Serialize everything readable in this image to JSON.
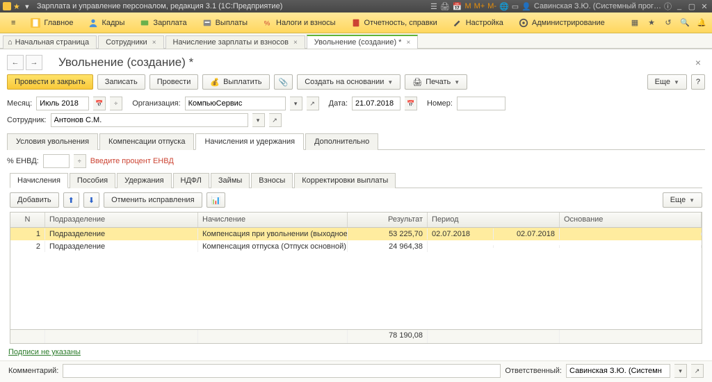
{
  "titlebar": {
    "app": "Зарплата и управление персоналом, редакция 3.1  (1С:Предприятие)",
    "user": "Савинская З.Ю. (Системный прог…"
  },
  "mainmenu": {
    "items": [
      "Главное",
      "Кадры",
      "Зарплата",
      "Выплаты",
      "Налоги и взносы",
      "Отчетность, справки",
      "Настройка",
      "Администрирование"
    ]
  },
  "tabs": {
    "items": [
      {
        "label": "Начальная страница",
        "home": true
      },
      {
        "label": "Сотрудники",
        "close": true
      },
      {
        "label": "Начисление зарплаты и взносов",
        "close": true
      },
      {
        "label": "Увольнение (создание) *",
        "close": true,
        "active": true
      }
    ]
  },
  "page": {
    "title": "Увольнение (создание) *"
  },
  "toolbar": {
    "post_close": "Провести и закрыть",
    "write": "Записать",
    "post": "Провести",
    "pay": "Выплатить",
    "create": "Создать на основании",
    "print": "Печать",
    "more": "Еще"
  },
  "form": {
    "month_lbl": "Месяц:",
    "month": "Июль 2018",
    "org_lbl": "Организация:",
    "org": "КомпьюСервис",
    "date_lbl": "Дата:",
    "date": "21.07.2018",
    "number_lbl": "Номер:",
    "number": "",
    "emp_lbl": "Сотрудник:",
    "emp": "Антонов С.М."
  },
  "subtabs": {
    "items": [
      "Условия увольнения",
      "Компенсации отпуска",
      "Начисления и удержания",
      "Дополнительно"
    ],
    "active": 2
  },
  "envd": {
    "lbl": "% ЕНВД:",
    "val": "",
    "warn": "Введите процент ЕНВД"
  },
  "innertabs": {
    "items": [
      "Начисления",
      "Пособия",
      "Удержания",
      "НДФЛ",
      "Займы",
      "Взносы",
      "Корректировки выплаты"
    ],
    "active": 0
  },
  "tabletools": {
    "add": "Добавить",
    "cancel": "Отменить исправления",
    "more": "Еще"
  },
  "grid": {
    "cols": {
      "n": "N",
      "sub": "Подразделение",
      "nac": "Начисление",
      "res": "Результат",
      "per": "Период",
      "osn": "Основание"
    },
    "rows": [
      {
        "n": "1",
        "sub": "Подразделение",
        "nac": "Компенсация при увольнении (выходное пособие)",
        "res": "53 225,70",
        "per_from": "02.07.2018",
        "per_to": "02.07.2018",
        "osn": "",
        "sel": true
      },
      {
        "n": "2",
        "sub": "Подразделение",
        "nac": "Компенсация отпуска (Отпуск основной)",
        "res": "24 964,38",
        "per_from": "",
        "per_to": "",
        "osn": ""
      }
    ],
    "total": "78 190,08"
  },
  "footer": {
    "sign_link": "Подписи не указаны",
    "comment_lbl": "Комментарий:",
    "resp_lbl": "Ответственный:",
    "resp": "Савинская З.Ю. (Системн"
  }
}
